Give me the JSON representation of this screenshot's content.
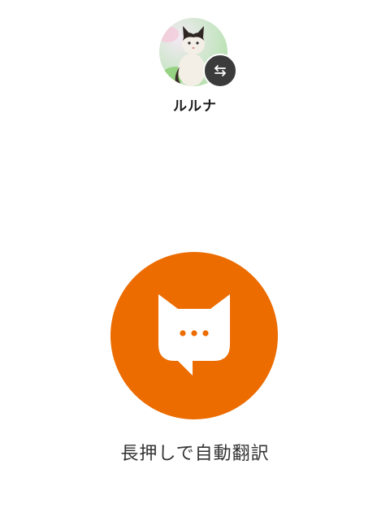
{
  "profile": {
    "name": "ルルナ",
    "avatar_icon": "cat-avatar",
    "switch_icon": "switch-arrows-icon"
  },
  "main": {
    "talk_button_icon": "cat-chat-bubble-icon",
    "hint": "長押しで自動翻訳"
  },
  "colors": {
    "accent": "#ec6c00",
    "badge": "#3b3b3b"
  }
}
